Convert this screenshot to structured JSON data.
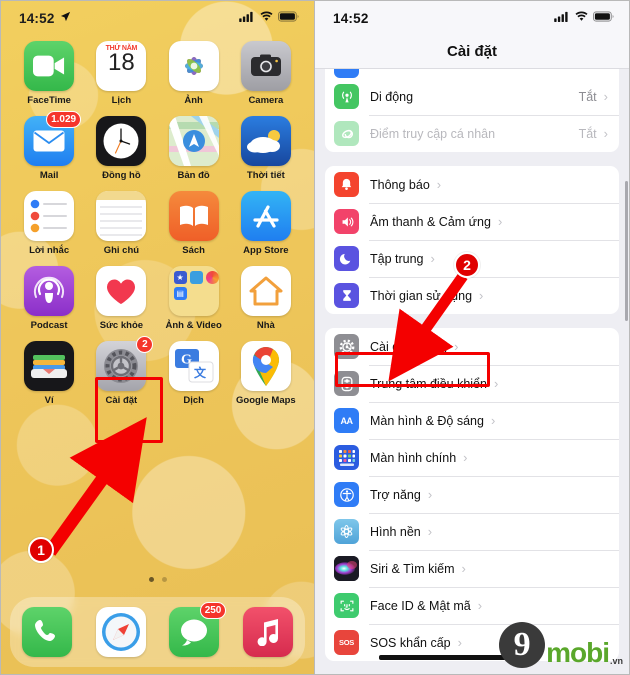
{
  "left_phone": {
    "status_bar": {
      "time": "14:52",
      "location_icon": "location-arrow-icon",
      "signal_icon": "cellular-signal-icon",
      "wifi_icon": "wifi-icon",
      "battery_icon": "battery-icon"
    },
    "apps": [
      {
        "name": "FaceTime",
        "icon": "facetime-icon",
        "badge": ""
      },
      {
        "name": "Lịch",
        "icon": "calendar-icon",
        "badge": "",
        "cal_top": "THỨ NĂM",
        "cal_day": "18"
      },
      {
        "name": "Ảnh",
        "icon": "photos-icon",
        "badge": ""
      },
      {
        "name": "Camera",
        "icon": "camera-icon",
        "badge": ""
      },
      {
        "name": "Mail",
        "icon": "mail-icon",
        "badge": "1.029"
      },
      {
        "name": "Đồng hồ",
        "icon": "clock-icon",
        "badge": ""
      },
      {
        "name": "Bản đồ",
        "icon": "maps-icon",
        "badge": ""
      },
      {
        "name": "Thời tiết",
        "icon": "weather-icon",
        "badge": ""
      },
      {
        "name": "Lời nhắc",
        "icon": "reminders-icon",
        "badge": ""
      },
      {
        "name": "Ghi chú",
        "icon": "notes-icon",
        "badge": ""
      },
      {
        "name": "Sách",
        "icon": "books-icon",
        "badge": ""
      },
      {
        "name": "App Store",
        "icon": "appstore-icon",
        "badge": ""
      },
      {
        "name": "Podcast",
        "icon": "podcasts-icon",
        "badge": ""
      },
      {
        "name": "Sức khỏe",
        "icon": "health-icon",
        "badge": ""
      },
      {
        "name": "Ảnh & Video",
        "icon": "folder-icon",
        "badge": ""
      },
      {
        "name": "Nhà",
        "icon": "home-icon",
        "badge": ""
      },
      {
        "name": "Ví",
        "icon": "wallet-icon",
        "badge": ""
      },
      {
        "name": "Cài đặt",
        "icon": "settings-gear-icon",
        "badge": "2"
      },
      {
        "name": "Dịch",
        "icon": "google-translate-icon",
        "badge": ""
      },
      {
        "name": "Google Maps",
        "icon": "google-maps-icon",
        "badge": ""
      }
    ],
    "dock": [
      {
        "name": "Điện thoại",
        "icon": "phone-icon",
        "badge": ""
      },
      {
        "name": "Safari",
        "icon": "safari-compass-icon",
        "badge": ""
      },
      {
        "name": "Tin nhắn",
        "icon": "messages-icon",
        "badge": "250"
      },
      {
        "name": "Nhạc",
        "icon": "music-note-icon",
        "badge": ""
      }
    ],
    "callout": {
      "step_number": "1",
      "highlight_target": "Cài đặt"
    }
  },
  "right_phone": {
    "status_bar": {
      "time": "14:52",
      "signal_icon": "cellular-signal-icon",
      "wifi_icon": "wifi-icon",
      "battery_icon": "battery-icon"
    },
    "nav_title": "Cài đặt",
    "groups": [
      {
        "rows": [
          {
            "label": "Di động",
            "value": "Tắt",
            "icon": "cellular-antenna-icon",
            "icon_color": "#44c662",
            "dim": false
          },
          {
            "label": "Điểm truy cập cá nhân",
            "value": "Tắt",
            "icon": "hotspot-link-icon",
            "icon_color": "#44c662",
            "dim": true
          }
        ]
      },
      {
        "rows": [
          {
            "label": "Thông báo",
            "value": "",
            "icon": "notification-bell-icon",
            "icon_color": "#f4442e",
            "dim": false
          },
          {
            "label": "Âm thanh & Cảm ứng",
            "value": "",
            "icon": "sound-speaker-icon",
            "icon_color": "#f2436a",
            "dim": false
          },
          {
            "label": "Tập trung",
            "value": "",
            "icon": "focus-moon-icon",
            "icon_color": "#5a53e0",
            "dim": false
          },
          {
            "label": "Thời gian sử dụng",
            "value": "",
            "icon": "screentime-hourglass-icon",
            "icon_color": "#5a53e0",
            "dim": false
          }
        ]
      },
      {
        "rows": [
          {
            "label": "Cài đặt chung",
            "value": "",
            "icon": "general-gear-icon",
            "icon_color": "#8e8e93",
            "dim": false,
            "highlighted": true
          },
          {
            "label": "Trung tâm điều khiển",
            "value": "",
            "icon": "control-center-icon",
            "icon_color": "#8e8e93",
            "dim": false
          },
          {
            "label": "Màn hình & Độ sáng",
            "value": "",
            "icon": "display-brightness-icon",
            "icon_color": "#2f7cf6",
            "dim": false
          },
          {
            "label": "Màn hình chính",
            "value": "",
            "icon": "home-screen-grid-icon",
            "icon_color": "#2b5ce0",
            "dim": false
          },
          {
            "label": "Trợ năng",
            "value": "",
            "icon": "accessibility-icon",
            "icon_color": "#2f7cf6",
            "dim": false
          },
          {
            "label": "Hình nền",
            "value": "",
            "icon": "wallpaper-flower-icon",
            "icon_color": "#57b0e0",
            "dim": false
          },
          {
            "label": "Siri & Tìm kiếm",
            "value": "",
            "icon": "siri-orb-icon",
            "icon_color": "#2a2a38",
            "dim": false
          },
          {
            "label": "Face ID & Mật mã",
            "value": "",
            "icon": "faceid-icon",
            "icon_color": "#3ecb6e",
            "dim": false
          },
          {
            "label": "SOS khẩn cấp",
            "value": "",
            "icon": "sos-icon",
            "icon_color": "#e8453c",
            "dim": false
          }
        ]
      }
    ],
    "callout": {
      "step_number": "2",
      "highlight_target": "Cài đặt chung"
    },
    "chevron_glyph": "›"
  },
  "watermark": {
    "mark": "9",
    "text": "mobi",
    "tld": ".vn"
  },
  "colors": {
    "callout_red": "#f40000",
    "badge_red": "#f5352b",
    "wallpaper": "#eec65a",
    "list_bg": "#eeeef3",
    "row_bg": "#ffffff",
    "watermark_green": "#5aa72b"
  }
}
